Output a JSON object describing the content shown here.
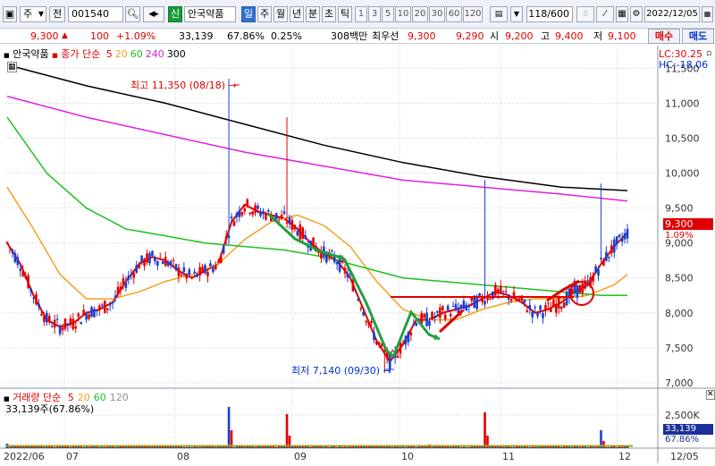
{
  "toolbar": {
    "market": "주",
    "prev_label": "전",
    "code": "001540",
    "credit_badge": "신",
    "stock_name": "안국약품",
    "periods": [
      "일",
      "주",
      "월",
      "년",
      "분",
      "초",
      "틱"
    ],
    "selected_period": "일",
    "intervals": [
      "1",
      "3",
      "5",
      "10",
      "20",
      "30",
      "60",
      "120"
    ],
    "count": "118/600",
    "date": "2022/12/05"
  },
  "quote": {
    "price": "9,300",
    "change": "100",
    "change_pct": "+1.09%",
    "volume": "33,139",
    "volume_ratio": "67.86%",
    "turnover": "0.25%",
    "amount": "308백만",
    "hoga_label": "최우선",
    "ask": "9,300",
    "bid": "9,290",
    "open_label": "시",
    "open": "9,200",
    "high_label": "고",
    "high": "9,400",
    "low_label": "저",
    "low": "9,100",
    "buy_button": "매수",
    "sell_button": "매도"
  },
  "price_panel": {
    "name": "안국약품",
    "ma_label": "종가 단순",
    "ma_periods": [
      "5",
      "20",
      "60",
      "240",
      "300"
    ],
    "ma_colors": {
      "5": "#e00000",
      "20": "#f5a020",
      "60": "#20c020",
      "240": "#e020e0",
      "300": "#000000"
    },
    "lc": "LC:30.25",
    "hc": "HC:-18.06",
    "high_note": "최고 11,350 (08/18)",
    "low_note": "최저 7,140 (09/30)",
    "current_price_tag": "9,300",
    "current_pct_tag": "1.09%"
  },
  "volume_panel": {
    "name": "거래량",
    "ma_label": "단순",
    "ma_periods": [
      "5",
      "20",
      "60",
      "120"
    ],
    "summary": "33,139주(67.86%)",
    "current_tag": "33,139",
    "current_pct": "67.86%"
  },
  "chart_data": {
    "type": "candlestick",
    "title": "안국약품",
    "y_ticks": [
      "11,500",
      "11,000",
      "10,500",
      "10,000",
      "9,500",
      "9,000",
      "8,500",
      "8,000",
      "7,500",
      "7,000"
    ],
    "ylim": [
      6960,
      11620
    ],
    "volume_ticks": [
      "2,500K"
    ],
    "x_ticks": [
      "2022/06",
      "07",
      "08",
      "09",
      "10",
      "11",
      "12",
      "12/05"
    ],
    "series": [
      {
        "name": "5",
        "points": [
          [
            0,
            9000
          ],
          [
            5,
            8700
          ],
          [
            10,
            8250
          ],
          [
            15,
            7900
          ],
          [
            20,
            7800
          ],
          [
            25,
            7850
          ],
          [
            30,
            8000
          ],
          [
            35,
            8050
          ],
          [
            40,
            8150
          ],
          [
            45,
            8450
          ],
          [
            50,
            8700
          ],
          [
            55,
            8800
          ],
          [
            60,
            8750
          ],
          [
            65,
            8600
          ],
          [
            70,
            8500
          ],
          [
            75,
            8600
          ],
          [
            80,
            8700
          ],
          [
            85,
            9300
          ],
          [
            90,
            9550
          ],
          [
            95,
            9450
          ],
          [
            100,
            9400
          ],
          [
            105,
            9350
          ],
          [
            110,
            9200
          ],
          [
            115,
            9000
          ],
          [
            120,
            8850
          ],
          [
            125,
            8750
          ],
          [
            130,
            8500
          ],
          [
            135,
            8050
          ],
          [
            140,
            7600
          ],
          [
            145,
            7300
          ],
          [
            150,
            7550
          ],
          [
            155,
            7900
          ],
          [
            160,
            7900
          ],
          [
            165,
            8000
          ],
          [
            170,
            8050
          ],
          [
            175,
            8100
          ],
          [
            180,
            8200
          ],
          [
            185,
            8300
          ],
          [
            190,
            8250
          ],
          [
            195,
            8150
          ],
          [
            200,
            8000
          ],
          [
            205,
            8050
          ],
          [
            210,
            8150
          ],
          [
            215,
            8300
          ],
          [
            220,
            8400
          ],
          [
            225,
            8700
          ],
          [
            230,
            8950
          ],
          [
            235,
            9150
          ]
        ]
      },
      {
        "name": "20",
        "points": [
          [
            0,
            9800
          ],
          [
            10,
            9200
          ],
          [
            20,
            8550
          ],
          [
            30,
            8200
          ],
          [
            40,
            8200
          ],
          [
            50,
            8300
          ],
          [
            60,
            8450
          ],
          [
            70,
            8550
          ],
          [
            80,
            8700
          ],
          [
            90,
            9050
          ],
          [
            100,
            9300
          ],
          [
            110,
            9400
          ],
          [
            120,
            9250
          ],
          [
            130,
            8950
          ],
          [
            140,
            8450
          ],
          [
            150,
            8050
          ],
          [
            160,
            7900
          ],
          [
            170,
            7900
          ],
          [
            180,
            8050
          ],
          [
            190,
            8150
          ],
          [
            200,
            8200
          ],
          [
            210,
            8200
          ],
          [
            220,
            8250
          ],
          [
            230,
            8400
          ],
          [
            235,
            8550
          ]
        ]
      },
      {
        "name": "60",
        "points": [
          [
            0,
            10800
          ],
          [
            15,
            10000
          ],
          [
            30,
            9500
          ],
          [
            45,
            9200
          ],
          [
            60,
            9100
          ],
          [
            75,
            9000
          ],
          [
            90,
            8950
          ],
          [
            105,
            8900
          ],
          [
            120,
            8800
          ],
          [
            135,
            8650
          ],
          [
            150,
            8500
          ],
          [
            165,
            8450
          ],
          [
            180,
            8400
          ],
          [
            195,
            8350
          ],
          [
            210,
            8300
          ],
          [
            225,
            8250
          ],
          [
            235,
            8250
          ]
        ]
      },
      {
        "name": "240",
        "points": [
          [
            0,
            11100
          ],
          [
            30,
            10800
          ],
          [
            60,
            10550
          ],
          [
            90,
            10300
          ],
          [
            120,
            10100
          ],
          [
            150,
            9900
          ],
          [
            180,
            9800
          ],
          [
            210,
            9700
          ],
          [
            235,
            9600
          ]
        ]
      },
      {
        "name": "300",
        "points": [
          [
            0,
            11550
          ],
          [
            30,
            11250
          ],
          [
            60,
            11000
          ],
          [
            90,
            10700
          ],
          [
            120,
            10400
          ],
          [
            150,
            10150
          ],
          [
            180,
            9950
          ],
          [
            210,
            9800
          ],
          [
            235,
            9750
          ]
        ]
      }
    ]
  }
}
